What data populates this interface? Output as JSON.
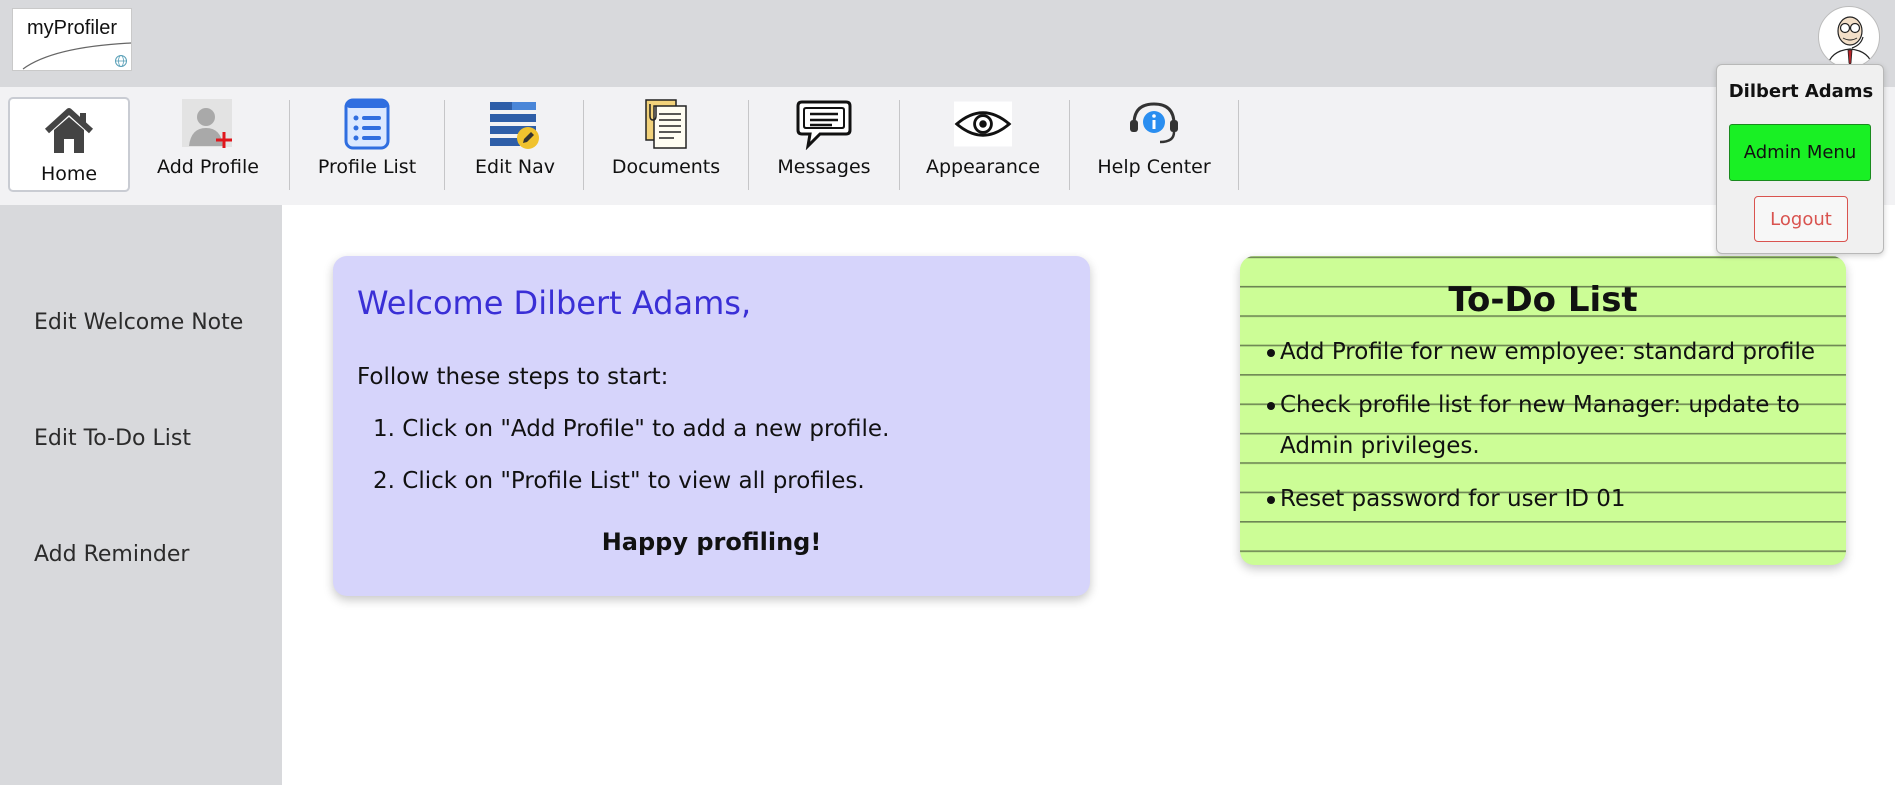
{
  "app": {
    "logo_text": "myProfiler",
    "logo_icon": "globe-icon"
  },
  "user": {
    "name": "Dilbert Adams",
    "admin_label": "Admin Menu",
    "logout_label": "Logout",
    "avatar_icon": "user-avatar-icon"
  },
  "nav": {
    "items": [
      {
        "label": "Home",
        "icon": "home-icon"
      },
      {
        "label": "Add Profile",
        "icon": "add-profile-icon"
      },
      {
        "label": "Profile List",
        "icon": "profile-list-icon"
      },
      {
        "label": "Edit Nav",
        "icon": "edit-nav-icon"
      },
      {
        "label": "Documents",
        "icon": "documents-icon"
      },
      {
        "label": "Messages",
        "icon": "messages-icon"
      },
      {
        "label": "Appearance",
        "icon": "eye-icon"
      },
      {
        "label": "Help Center",
        "icon": "help-center-icon"
      }
    ]
  },
  "sidebar": {
    "items": [
      {
        "label": "Edit Welcome Note"
      },
      {
        "label": "Edit To-Do List"
      },
      {
        "label": "Add Reminder"
      }
    ]
  },
  "welcome": {
    "title": "Welcome Dilbert Adams,",
    "intro": "Follow these steps to start:",
    "steps": [
      "1. Click on \"Add Profile\" to add a new profile.",
      "2. Click on \"Profile List\" to view all profiles."
    ],
    "footer": "Happy profiling!"
  },
  "todo": {
    "title": "To-Do List",
    "items": [
      "Add Profile for new employee: standard profile",
      "Check profile list for new Manager: update to Admin privileges.",
      "Reset password for user ID 01"
    ]
  },
  "colors": {
    "welcome_bg": "#d6d4fb",
    "welcome_title": "#3a2fd6",
    "todo_bg": "#ccfd96",
    "admin_btn": "#19f024",
    "logout": "#d9534f"
  }
}
